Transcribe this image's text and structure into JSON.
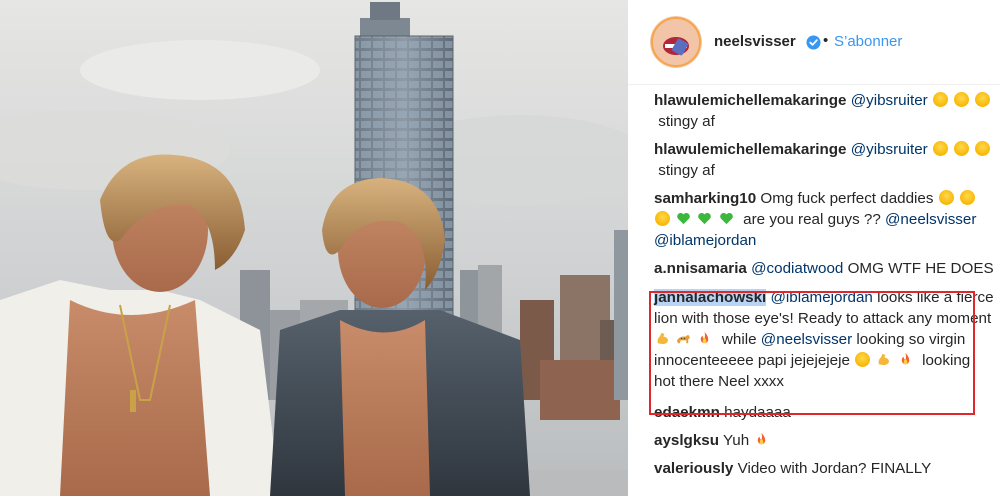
{
  "post": {
    "author": "neelsvisser",
    "verified": true,
    "separator": "•",
    "follow_label": "S’abonner"
  },
  "comments": [
    {
      "user": "hlawulemichellemakaringe",
      "mention": "@yibsruiter",
      "after_emoji": [
        "laugh",
        "laugh",
        "laugh"
      ],
      "text": "stingy af"
    },
    {
      "user": "hlawulemichellemakaringe",
      "mention": "@yibsruiter",
      "after_emoji": [
        "laugh",
        "laugh",
        "laugh"
      ],
      "text": "stingy af"
    },
    {
      "user": "samharking10",
      "text1": "Omg fuck perfect daddies",
      "text2": "are you real guys ??",
      "mention1": "@neelsvisser",
      "mention2": "@iblamejordan"
    },
    {
      "user": "a.nnisamaria",
      "mention": "@codiatwood",
      "text": "OMG WTF HE DOES"
    },
    {
      "user": "jannalachowski",
      "mention1": "@iblamejordan",
      "text1": "looks like a fierce lion with those eye's! Ready to attack any moment",
      "text2": "while",
      "mention2": "@neelsvisser",
      "text3": "looking so virgin innocenteeeee papi jejejejeje",
      "text4": "looking hot there Neel xxxx",
      "highlighted": true
    },
    {
      "user": "edaekmn",
      "text": "haydaaaa"
    },
    {
      "user": "ayslgksu",
      "text": "Yuh"
    },
    {
      "user": "valeriously",
      "text": "Video with Jordan? FINALLY"
    }
  ],
  "colors": {
    "username": "#262626",
    "mention": "#003569",
    "follow": "#3897f0",
    "verified": "#3897f0",
    "highlight_border": "#e0272b",
    "selection": "#b8d4f4"
  },
  "icons": [
    "avatar",
    "verified-badge-icon",
    "laugh-emoji-icon",
    "green-heart-emoji-icon",
    "muscle-emoji-icon",
    "leopard-emoji-icon",
    "fire-emoji-icon",
    "wink-emoji-icon"
  ]
}
